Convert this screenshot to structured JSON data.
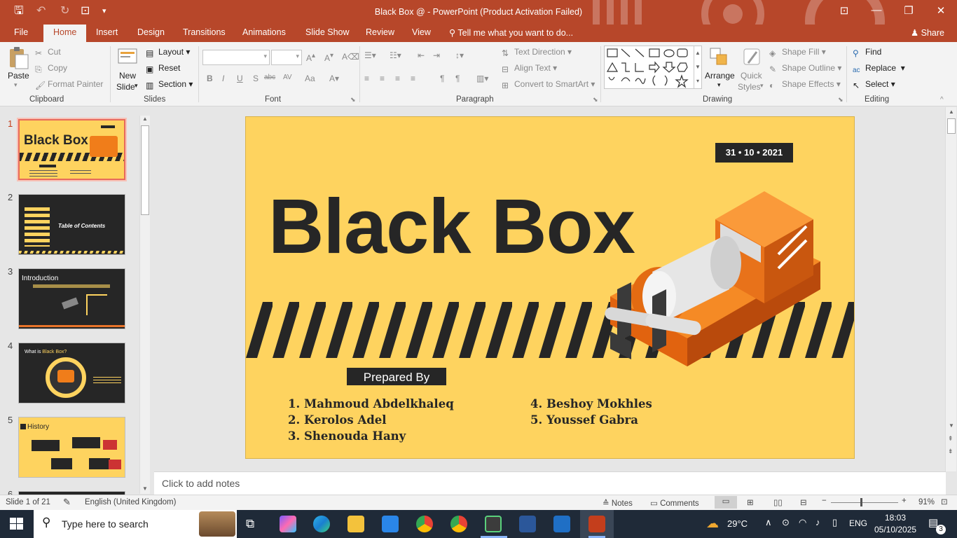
{
  "titlebar": {
    "title": "Black Box @ - PowerPoint (Product Activation Failed)",
    "minimize": "—",
    "restore": "❐",
    "close": "✕"
  },
  "tabs": {
    "file": "File",
    "home": "Home",
    "insert": "Insert",
    "design": "Design",
    "transitions": "Transitions",
    "animations": "Animations",
    "slideshow": "Slide Show",
    "review": "Review",
    "view": "View",
    "tellme": "Tell me what you want to do...",
    "share": "Share"
  },
  "ribbon": {
    "clipboard": {
      "paste": "Paste",
      "cut": "Cut",
      "copy": "Copy",
      "format_painter": "Format Painter",
      "label": "Clipboard"
    },
    "slides": {
      "new_slide_1": "New",
      "new_slide_2": "Slide",
      "layout": "Layout",
      "reset": "Reset",
      "section": "Section",
      "label": "Slides"
    },
    "font": {
      "label": "Font",
      "bold": "B",
      "italic": "I",
      "underline": "U",
      "strike": "S",
      "abc": "abc",
      "spacing": "AV",
      "case": "Aa"
    },
    "paragraph": {
      "label": "Paragraph",
      "text_direction": "Text Direction",
      "align_text": "Align Text",
      "convert_smartart": "Convert to SmartArt"
    },
    "drawing": {
      "label": "Drawing",
      "arrange": "Arrange",
      "quick_styles_1": "Quick",
      "quick_styles_2": "Styles",
      "shape_fill": "Shape Fill",
      "shape_outline": "Shape Outline",
      "shape_effects": "Shape Effects"
    },
    "editing": {
      "label": "Editing",
      "find": "Find",
      "replace": "Replace",
      "select": "Select"
    }
  },
  "thumbnails": {
    "numbers": [
      "1",
      "2",
      "3",
      "4",
      "5",
      "6"
    ],
    "t1_title": "Black Box",
    "t2_title": "Table of Contents",
    "t2_items": [
      "01",
      "02",
      "03",
      "04",
      "05",
      "06"
    ],
    "t3_title": "Introduction",
    "t4_title_a": "What is ",
    "t4_title_b": "Black Box?",
    "t5_title": "History"
  },
  "slide": {
    "date": "31 • 10 • 2021",
    "title": "Black Box",
    "prepared_by": "Prepared By",
    "members_left": [
      "1. Mahmoud Abdelkhaleq",
      "2. Kerolos Adel",
      "3. Shenouda Hany"
    ],
    "members_right": [
      "4. Beshoy Mokhles",
      "5. Youssef Gabra"
    ]
  },
  "notes": {
    "placeholder": "Click to add notes"
  },
  "status": {
    "slide_count": "Slide 1 of 21",
    "language": "English (United Kingdom)",
    "notes": "Notes",
    "comments": "Comments",
    "zoom": "91%"
  },
  "taskbar": {
    "search_placeholder": "Type here to search",
    "weather": "29°C",
    "lang": "ENG",
    "time": "18:03",
    "date": "05/10/2025",
    "notif_count": "3"
  },
  "colors": {
    "accent": "#b7472a",
    "slide_bg": "#fed35f",
    "dark": "#262626",
    "orange": "#f07d1a"
  }
}
